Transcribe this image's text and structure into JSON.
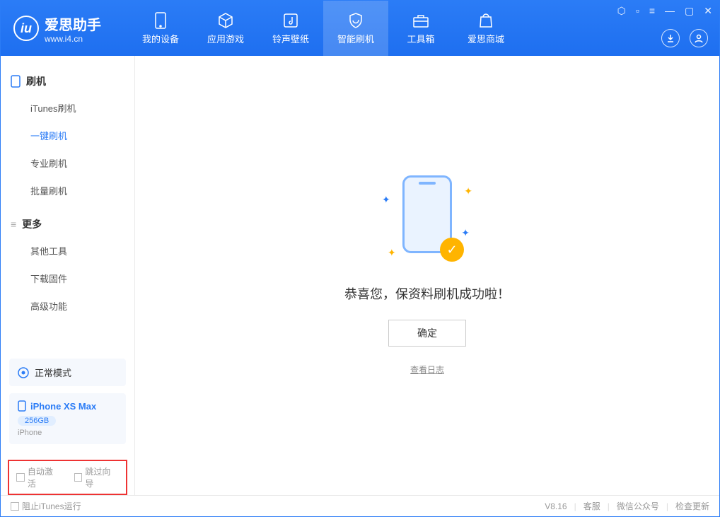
{
  "app": {
    "title": "爱思助手",
    "subtitle": "www.i4.cn"
  },
  "nav": {
    "items": [
      {
        "label": "我的设备"
      },
      {
        "label": "应用游戏"
      },
      {
        "label": "铃声壁纸"
      },
      {
        "label": "智能刷机"
      },
      {
        "label": "工具箱"
      },
      {
        "label": "爱思商城"
      }
    ]
  },
  "sidebar": {
    "group1": {
      "head": "刷机",
      "items": [
        "iTunes刷机",
        "一键刷机",
        "专业刷机",
        "批量刷机"
      ]
    },
    "group2": {
      "head": "更多",
      "items": [
        "其他工具",
        "下载固件",
        "高级功能"
      ]
    }
  },
  "mode": {
    "label": "正常模式"
  },
  "device": {
    "name": "iPhone XS Max",
    "capacity": "256GB",
    "type": "iPhone"
  },
  "options": {
    "auto_activate": "自动激活",
    "skip_guide": "跳过向导"
  },
  "main": {
    "success": "恭喜您，保资料刷机成功啦！",
    "ok": "确定",
    "view_log": "查看日志"
  },
  "footer": {
    "block_itunes": "阻止iTunes运行",
    "version": "V8.16",
    "support": "客服",
    "wechat": "微信公众号",
    "update": "检查更新"
  }
}
